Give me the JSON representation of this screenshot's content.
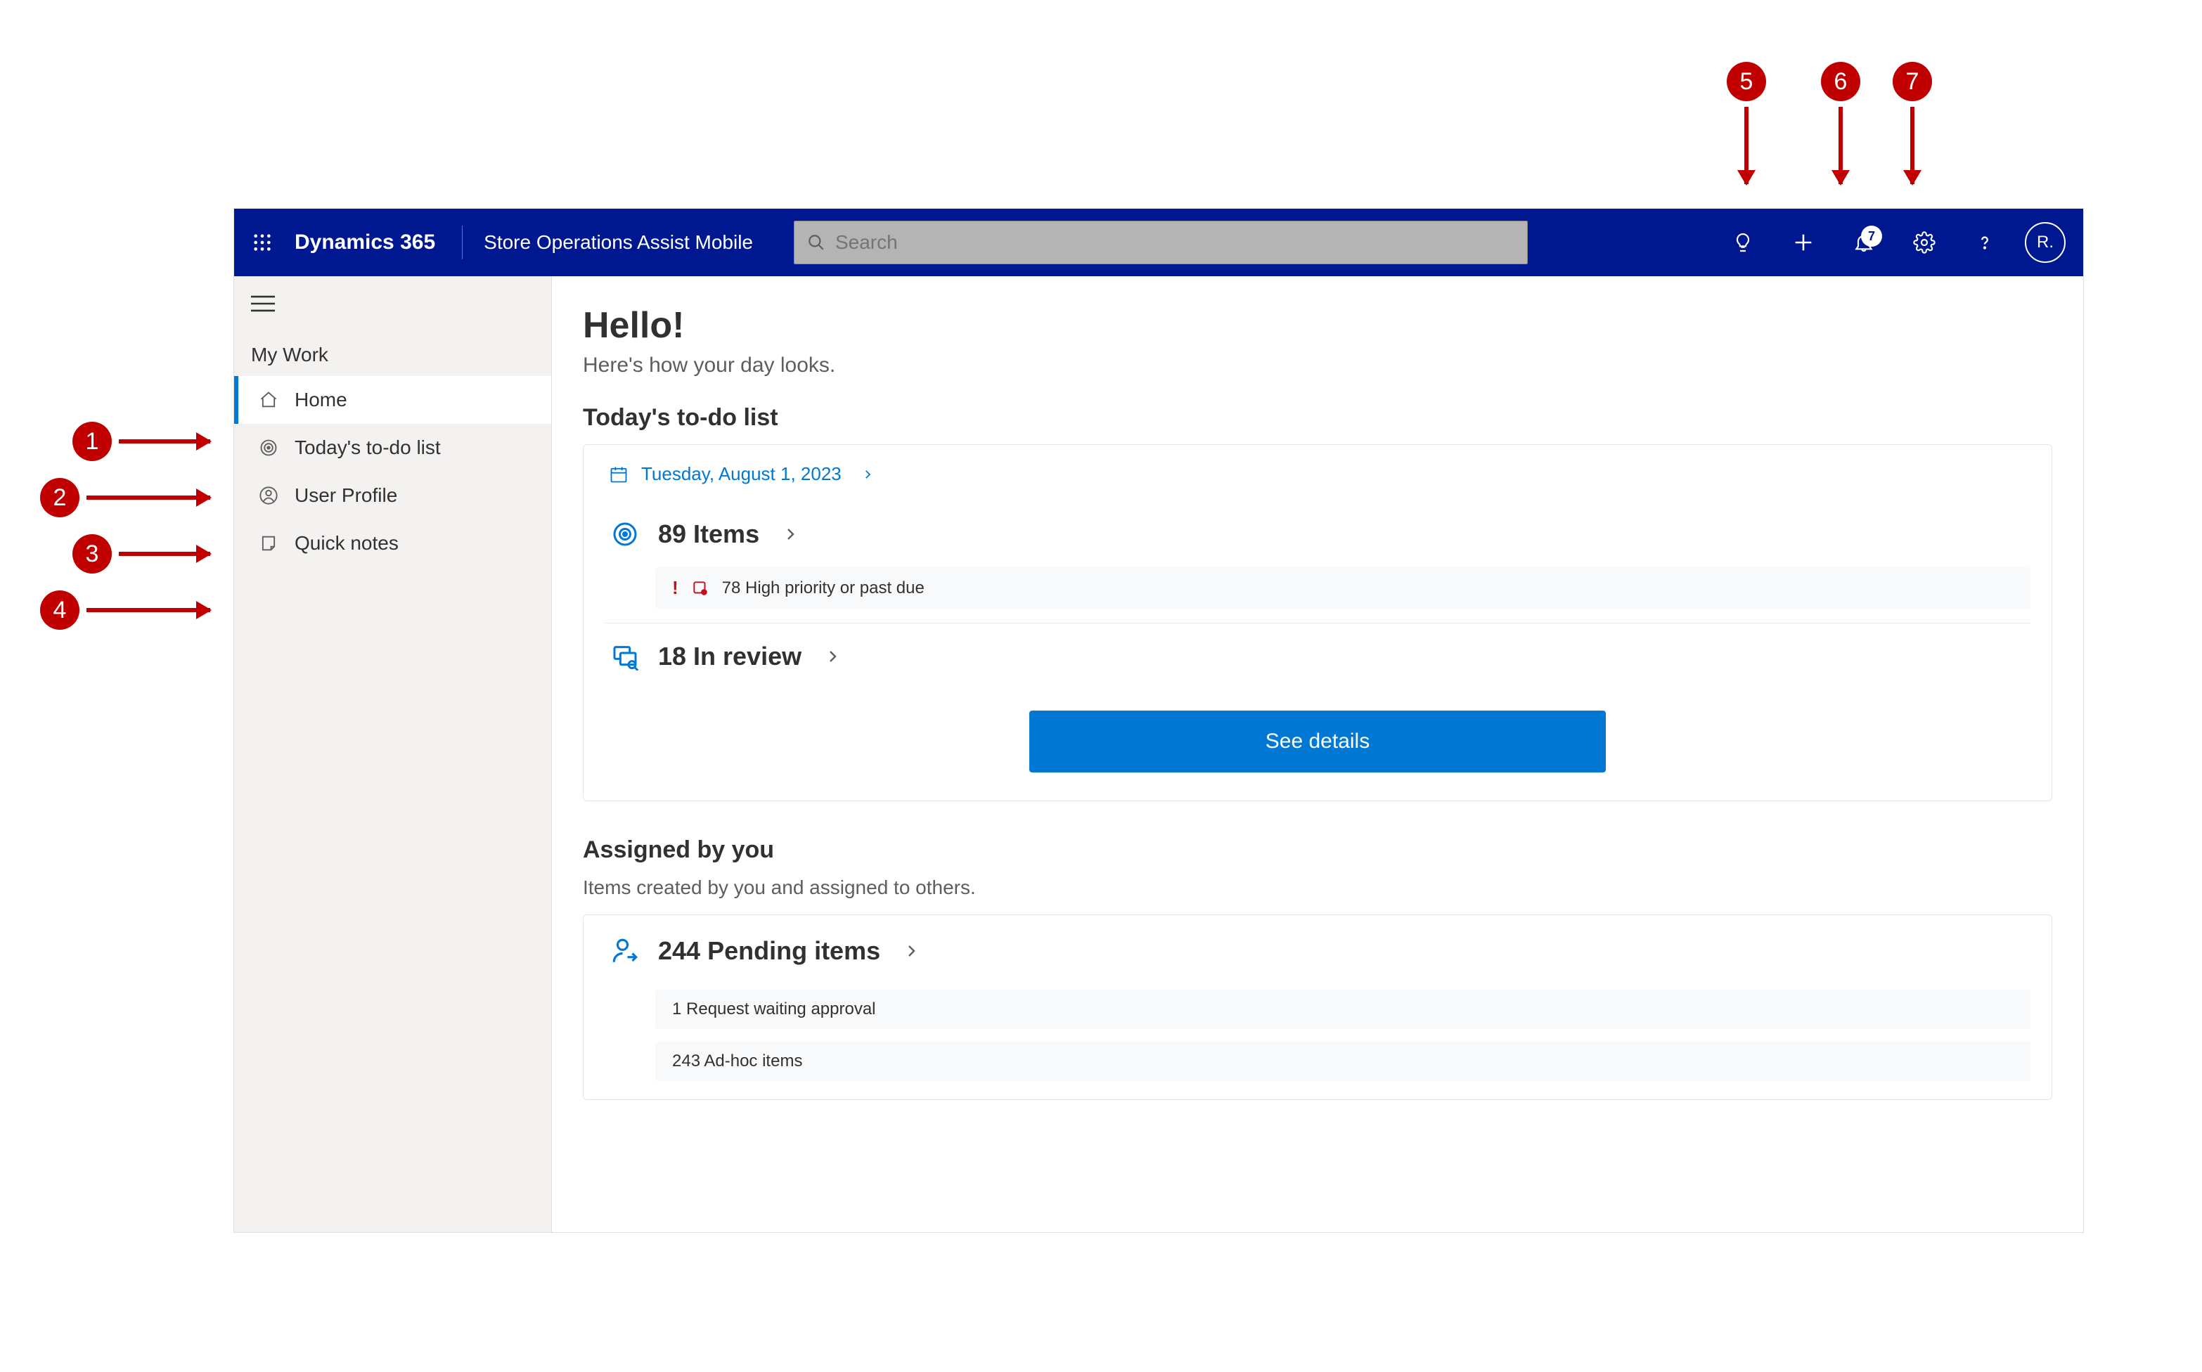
{
  "callouts": {
    "c1": "1",
    "c2": "2",
    "c3": "3",
    "c4": "4",
    "c5": "5",
    "c6": "6",
    "c7": "7"
  },
  "header": {
    "brand": "Dynamics 365",
    "appName": "Store Operations Assist Mobile",
    "searchPlaceholder": "Search",
    "notificationCount": "7",
    "avatarInitials": "R."
  },
  "sidebar": {
    "sectionLabel": "My Work",
    "items": [
      {
        "label": "Home"
      },
      {
        "label": "Today's to-do list"
      },
      {
        "label": "User Profile"
      },
      {
        "label": "Quick notes"
      }
    ]
  },
  "main": {
    "greeting": "Hello!",
    "subGreeting": "Here's how your day looks.",
    "todo": {
      "heading": "Today's to-do list",
      "date": "Tuesday, August 1, 2023",
      "itemsLabel": "89 Items",
      "priorityLabel": "78 High priority or past due",
      "reviewLabel": "18 In review",
      "detailsButton": "See details"
    },
    "assigned": {
      "heading": "Assigned by you",
      "desc": "Items created by you and assigned to others.",
      "pendingLabel": "244 Pending items",
      "row1": "1 Request waiting approval",
      "row2": "243 Ad-hoc items"
    }
  }
}
